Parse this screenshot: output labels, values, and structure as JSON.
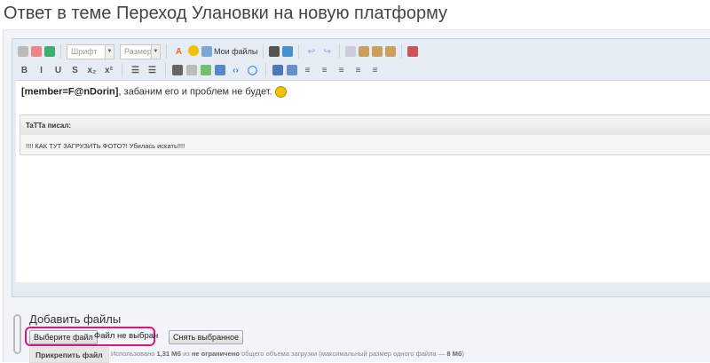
{
  "page_title": "Ответ в теме Переход Улановки на новую платформу",
  "toolbar": {
    "font_placeholder": "Шрифт",
    "size_placeholder": "Размер",
    "my_files": "Мои файлы",
    "row1_icons": [
      "source-icon",
      "eraser-icon",
      "remove-format-icon"
    ],
    "row1_after_icons": [
      "text-color-icon",
      "smiley-icon"
    ],
    "row1_tail_icons": [
      "printer-icon",
      "find-replace-icon",
      "|",
      "undo-icon",
      "redo-icon",
      "|",
      "copy-icon",
      "paste-icon",
      "paste-text-icon",
      "paste-word-icon",
      "|",
      "spellcheck-icon"
    ],
    "row2_icons": [
      "bold-icon",
      "italic-icon",
      "underline-icon",
      "strike-icon",
      "subscript-icon",
      "superscript-icon",
      "|",
      "bullet-list-icon",
      "numbered-list-icon",
      "|",
      "link-icon",
      "unlink-icon",
      "image-icon",
      "media-icon",
      "code-icon",
      "quote-icon",
      "|",
      "spoiler-icon",
      "table-icon",
      "outdent-icon",
      "indent-icon",
      "align-left-icon",
      "align-center-icon",
      "align-right-icon"
    ]
  },
  "editor": {
    "member_tag": "[member=F@nDorin]",
    "message_text": ", забаним его и проблем не будет.",
    "quote_author": "TaTTa писал:",
    "quote_text": "!!!! КАК ТУТ ЗАГРУЗИТЬ ФОТО?! Убилась искать!!!!"
  },
  "attachments": {
    "heading": "Добавить файлы",
    "choose_file": "Выберите файл",
    "no_file": "Файл не выбран",
    "clear_selected": "Снять выбранное",
    "attach_file": "Прикрепить файл",
    "usage_prefix": "Использовано",
    "usage_used": "1,31 Мб",
    "usage_of": "из",
    "usage_limit": "не ограничено",
    "usage_suffix": "общего объема загрузки (максимальный размер одного файла —",
    "max_file": "8 Мб",
    "usage_close": ")"
  }
}
